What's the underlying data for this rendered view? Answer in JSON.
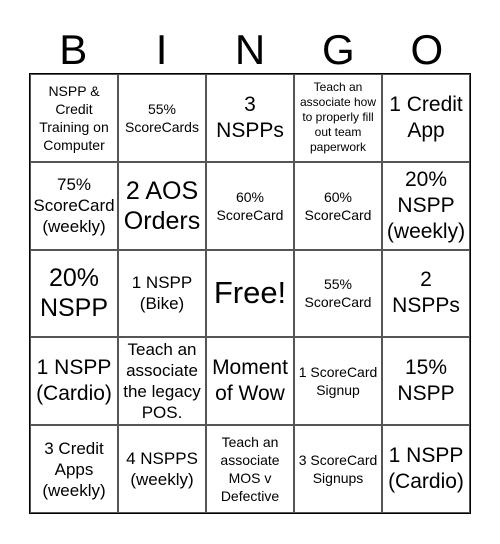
{
  "title_letters": [
    "B",
    "I",
    "N",
    "G",
    "O"
  ],
  "rows": [
    [
      "NSPP & Credit Training on Computer",
      "55% ScoreCards",
      "3 NSPPs",
      "Teach an associate how to properly fill out team paperwork",
      "1 Credit App"
    ],
    [
      "75% ScoreCard (weekly)",
      "2 AOS Orders",
      "60% ScoreCard",
      "60% ScoreCard",
      "20% NSPP (weekly)"
    ],
    [
      "20% NSPP",
      "1 NSPP (Bike)",
      "Free!",
      "55% ScoreCard",
      "2 NSPPs"
    ],
    [
      "1 NSPP (Cardio)",
      "Teach an associate the legacy POS.",
      "Moment of Wow",
      "1 ScoreCard Signup",
      "15% NSPP"
    ],
    [
      "3 Credit Apps (weekly)",
      "4 NSPPS (weekly)",
      "Teach an associate MOS v Defective",
      "3 ScoreCard Signups",
      "1 NSPP (Cardio)"
    ]
  ]
}
